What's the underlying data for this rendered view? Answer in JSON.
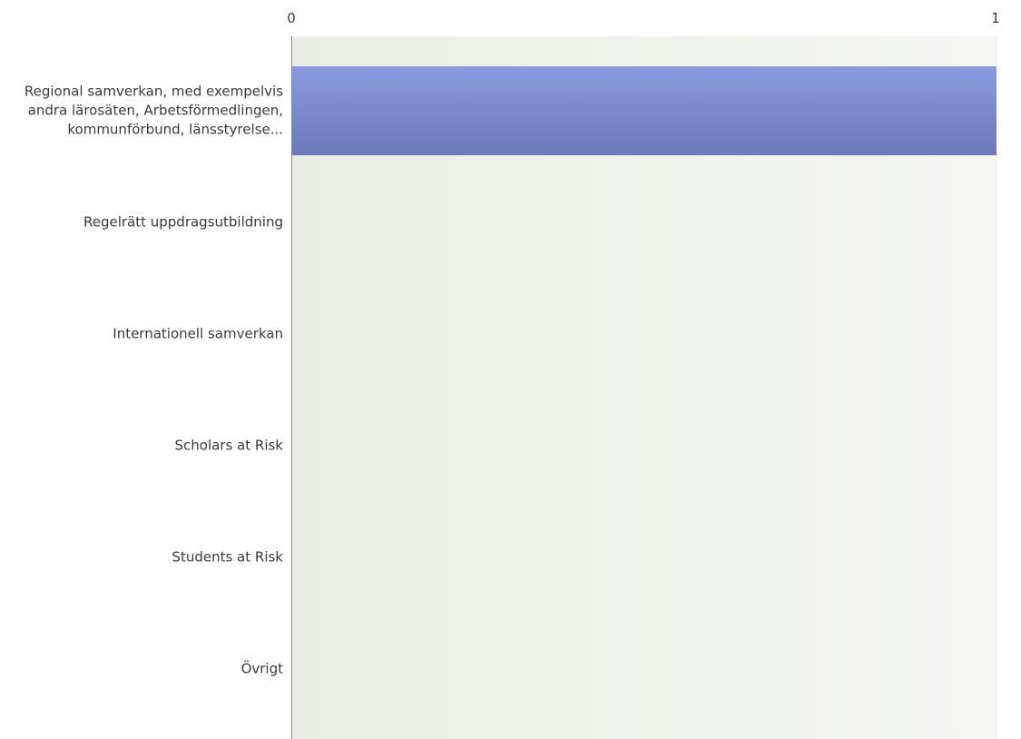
{
  "chart_data": {
    "type": "bar",
    "orientation": "horizontal",
    "categories": [
      "Regional samverkan, med exempelvis andra lärosäten, Arbetsförmedlingen, kommunförbund, länsstyrelse...",
      "Regelrätt uppdragsutbildning",
      "Internationell samverkan",
      "Scholars at Risk",
      "Students at Risk",
      "Övrigt"
    ],
    "values": [
      1,
      0,
      0,
      0,
      0,
      0
    ],
    "xlim": [
      0,
      1
    ],
    "x_ticks": [
      "0",
      "1"
    ],
    "axis_position": "top",
    "grid": true,
    "legend": "none",
    "colors": {
      "bar_top": "#8c9ae0",
      "bar_bottom": "#6b79b8",
      "plot_bg_left": "#e9ede4",
      "plot_bg_right": "#f6f7f4",
      "axis": "#888888",
      "text": "#3a3a3a"
    }
  }
}
